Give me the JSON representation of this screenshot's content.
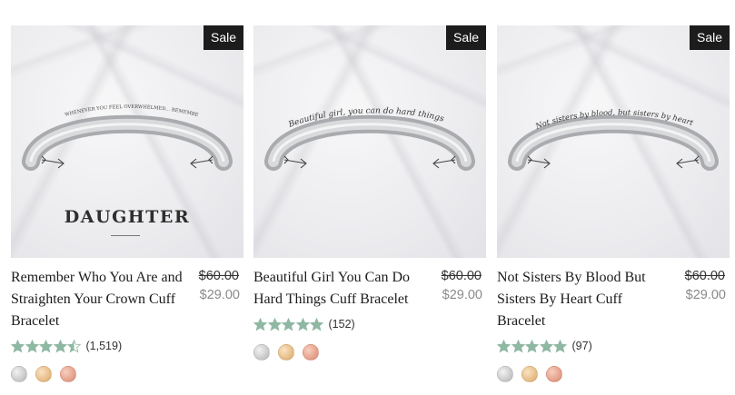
{
  "products": [
    {
      "sale_badge": "Sale",
      "image_text": "DAUGHTER",
      "engraving": "WHENEVER YOU FEEL OVERWHELMED... REMEMBER WHOSE DAUGHTER YOU ARE AND STRAIGHTEN YOUR CROWN",
      "title": "Remember Who You Are and Straighten Your Crown Cuff Bracelet",
      "price_original": "$60.00",
      "price_sale": "$29.00",
      "rating_stars": 4.5,
      "review_count": "(1,519)",
      "swatches": [
        "silver",
        "gold",
        "rose-gold"
      ]
    },
    {
      "sale_badge": "Sale",
      "image_text": "",
      "engraving": "Beautiful girl, you can do hard things",
      "title": "Beautiful Girl You Can Do Hard Things Cuff Bracelet",
      "price_original": "$60.00",
      "price_sale": "$29.00",
      "rating_stars": 5,
      "review_count": "(152)",
      "swatches": [
        "silver",
        "gold",
        "rose-gold"
      ]
    },
    {
      "sale_badge": "Sale",
      "image_text": "",
      "engraving": "Not sisters by blood, but sisters by heart.",
      "title": "Not Sisters By Blood But Sisters By Heart Cuff Bracelet",
      "price_original": "$60.00",
      "price_sale": "$29.00",
      "rating_stars": 5,
      "review_count": "(97)",
      "swatches": [
        "silver",
        "gold",
        "rose-gold"
      ]
    }
  ],
  "colors": {
    "star": "#8fb8a3",
    "badge_bg": "#1c1c1c",
    "sale_price": "#8a8a8a"
  }
}
